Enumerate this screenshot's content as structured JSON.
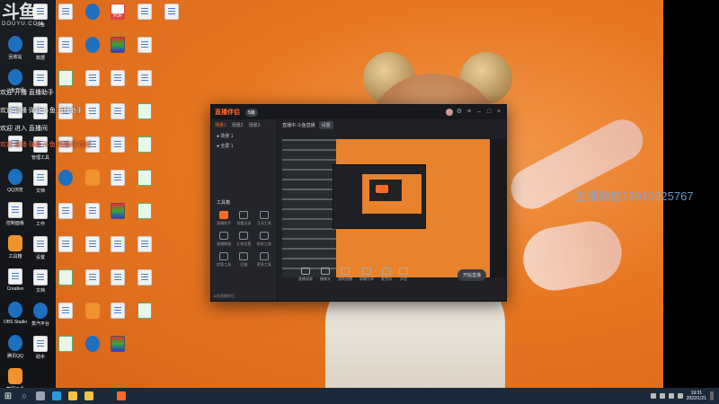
{
  "overlay": {
    "logo_mark": "斗鱼",
    "logo_sub": "DOUYU.COM",
    "tickers": [
      {
        "text": "欢迎 开播 直播助手",
        "color": "#ffffff"
      },
      {
        "text": "欢迎 直播 弹幕 斗鱼 直播助手",
        "color": "#ffffff"
      },
      {
        "text": "欢迎 进入 直播间",
        "color": "#ffffff"
      },
      {
        "text": "欢迎 直播 弹幕 斗鱼 直播间 欢迎",
        "color": "#ff6b4a"
      }
    ],
    "watermark": "主播微信19910325767"
  },
  "desktop": {
    "column1": [
      {
        "icon": "recycle-bin-icon",
        "label": "回收站",
        "kind": "round"
      },
      {
        "icon": "app-icon",
        "label": "斗鱼直播",
        "kind": "round"
      },
      {
        "icon": "app-icon",
        "label": "",
        "kind": "doc"
      },
      {
        "icon": "app-icon",
        "label": "",
        "kind": "doc"
      },
      {
        "icon": "qq-browser-icon",
        "label": "QQ浏览",
        "kind": "round"
      },
      {
        "icon": "app-icon",
        "label": "控制面板",
        "kind": "doc"
      },
      {
        "icon": "toolbox-icon",
        "label": "工具箱",
        "kind": "orange"
      },
      {
        "icon": "app-icon",
        "label": "Creative",
        "kind": "doc"
      },
      {
        "icon": "obs-icon",
        "label": "OBS Studio",
        "kind": "round"
      },
      {
        "icon": "qq-icon",
        "label": "腾讯QQ",
        "kind": "round"
      },
      {
        "icon": "app-icon",
        "label": "截图工具",
        "kind": "orange"
      }
    ],
    "column2": [
      {
        "icon": "word-doc-icon",
        "label": "斗鱼",
        "kind": "doc"
      },
      {
        "icon": "word-doc-icon",
        "label": "数据",
        "kind": "doc"
      },
      {
        "icon": "app-icon",
        "label": "",
        "kind": "doc"
      },
      {
        "icon": "app-icon",
        "label": "",
        "kind": "doc"
      },
      {
        "icon": "app-icon",
        "label": "管理工具",
        "kind": "doc"
      },
      {
        "icon": "app-icon",
        "label": "文档",
        "kind": "doc"
      },
      {
        "icon": "app-icon",
        "label": "工作",
        "kind": "doc"
      },
      {
        "icon": "word-doc-icon",
        "label": "设置",
        "kind": "doc"
      },
      {
        "icon": "app-icon",
        "label": "文档",
        "kind": "doc"
      },
      {
        "icon": "steam-icon",
        "label": "蒸汽平台",
        "kind": "round"
      },
      {
        "icon": "app-icon",
        "label": "助手",
        "kind": "doc"
      }
    ],
    "column3": [
      {
        "icon": "doc-icon",
        "label": "",
        "kind": "doc"
      },
      {
        "icon": "doc-icon",
        "label": "",
        "kind": "doc"
      },
      {
        "icon": "doc-icon",
        "label": "",
        "kind": "green"
      },
      {
        "icon": "doc-icon",
        "label": "",
        "kind": "doc"
      },
      {
        "icon": "doc-icon",
        "label": "",
        "kind": "doc"
      },
      {
        "icon": "doc-icon",
        "label": "",
        "kind": "round"
      },
      {
        "icon": "doc-icon",
        "label": "",
        "kind": "doc"
      },
      {
        "icon": "doc-icon",
        "label": "",
        "kind": "doc"
      },
      {
        "icon": "wechat-icon",
        "label": "",
        "kind": "green"
      },
      {
        "icon": "doc-icon",
        "label": "",
        "kind": "doc"
      },
      {
        "icon": "doc-icon",
        "label": "",
        "kind": "green"
      }
    ],
    "column4": [
      {
        "icon": "baidu-icon",
        "label": "",
        "kind": "round"
      },
      {
        "icon": "app-icon",
        "label": "",
        "kind": "round"
      },
      {
        "icon": "doc-icon",
        "label": "",
        "kind": "doc"
      },
      {
        "icon": "doc-icon",
        "label": "",
        "kind": "doc"
      },
      {
        "icon": "doc-icon",
        "label": "",
        "kind": "doc"
      },
      {
        "icon": "app-icon",
        "label": "",
        "kind": "orange"
      },
      {
        "icon": "doc-icon",
        "label": "",
        "kind": "doc"
      },
      {
        "icon": "doc-icon",
        "label": "",
        "kind": "doc"
      },
      {
        "icon": "doc-icon",
        "label": "",
        "kind": "doc"
      },
      {
        "icon": "app-icon",
        "label": "",
        "kind": "orange"
      },
      {
        "icon": "steam-icon",
        "label": "",
        "kind": "round"
      }
    ],
    "column5": [
      {
        "icon": "pdf-icon",
        "label": "",
        "kind": "pdf"
      },
      {
        "icon": "winrar-icon",
        "label": "",
        "kind": "rainbow"
      },
      {
        "icon": "doc-icon",
        "label": "",
        "kind": "doc"
      },
      {
        "icon": "doc-icon",
        "label": "",
        "kind": "doc"
      },
      {
        "icon": "doc-icon",
        "label": "",
        "kind": "doc"
      },
      {
        "icon": "doc-icon",
        "label": "",
        "kind": "doc"
      },
      {
        "icon": "winrar-icon",
        "label": "",
        "kind": "rainbow"
      },
      {
        "icon": "doc-icon",
        "label": "",
        "kind": "doc"
      },
      {
        "icon": "doc-icon",
        "label": "",
        "kind": "doc"
      },
      {
        "icon": "doc-icon",
        "label": "",
        "kind": "doc"
      },
      {
        "icon": "winrar-icon",
        "label": "",
        "kind": "rainbow"
      }
    ],
    "column6": [
      {
        "icon": "word-doc-icon",
        "label": "",
        "kind": "doc"
      },
      {
        "icon": "word-doc-icon",
        "label": "",
        "kind": "doc"
      },
      {
        "icon": "word-doc-icon",
        "label": "",
        "kind": "doc"
      },
      {
        "icon": "excel-icon",
        "label": "",
        "kind": "green"
      },
      {
        "icon": "excel-icon",
        "label": "",
        "kind": "green"
      },
      {
        "icon": "excel-icon",
        "label": "",
        "kind": "green"
      },
      {
        "icon": "excel-icon",
        "label": "",
        "kind": "green"
      },
      {
        "icon": "doc-icon",
        "label": "",
        "kind": "doc"
      },
      {
        "icon": "doc-icon",
        "label": "",
        "kind": "doc"
      },
      {
        "icon": "doc-icon",
        "label": "",
        "kind": "green"
      }
    ],
    "column7": [
      {
        "icon": "doc-icon",
        "label": "",
        "kind": "doc"
      }
    ]
  },
  "app": {
    "logo": "直播伴侣",
    "badge": "5级",
    "side_tabs": [
      "场景1",
      "场景2",
      "场景3"
    ],
    "scenes": [
      "● 场景 1",
      "● 全屏 1"
    ],
    "tools_title": "工具箱",
    "tools": [
      "直播助手",
      "观看记录",
      "互动工具",
      "直播数据",
      "礼物设置",
      "贴纸工具",
      "房管工具",
      "回放",
      "更多工具"
    ],
    "toolbar": [
      "直播中·斗鱼直播",
      "设置"
    ],
    "controls": [
      "直播录屏",
      "摄像头",
      "游戏直播",
      "屏幕分享",
      "麦克风",
      "声音"
    ],
    "start_button": "开始直播",
    "status": "斗鱼直播伴侣"
  },
  "taskbar": {
    "time": "19:31",
    "date": "2022/1/21",
    "apps": [
      {
        "icon": "taskview-icon",
        "color": "#9aa4b0"
      },
      {
        "icon": "edge-icon",
        "color": "#2b9ae0"
      },
      {
        "icon": "explorer-icon",
        "color": "#f5c342"
      },
      {
        "icon": "folder-icon",
        "color": "#f5c342"
      },
      {
        "icon": "steam-icon",
        "color": "#1b2838"
      },
      {
        "icon": "douyu-icon",
        "color": "#ff6a2b"
      }
    ]
  }
}
